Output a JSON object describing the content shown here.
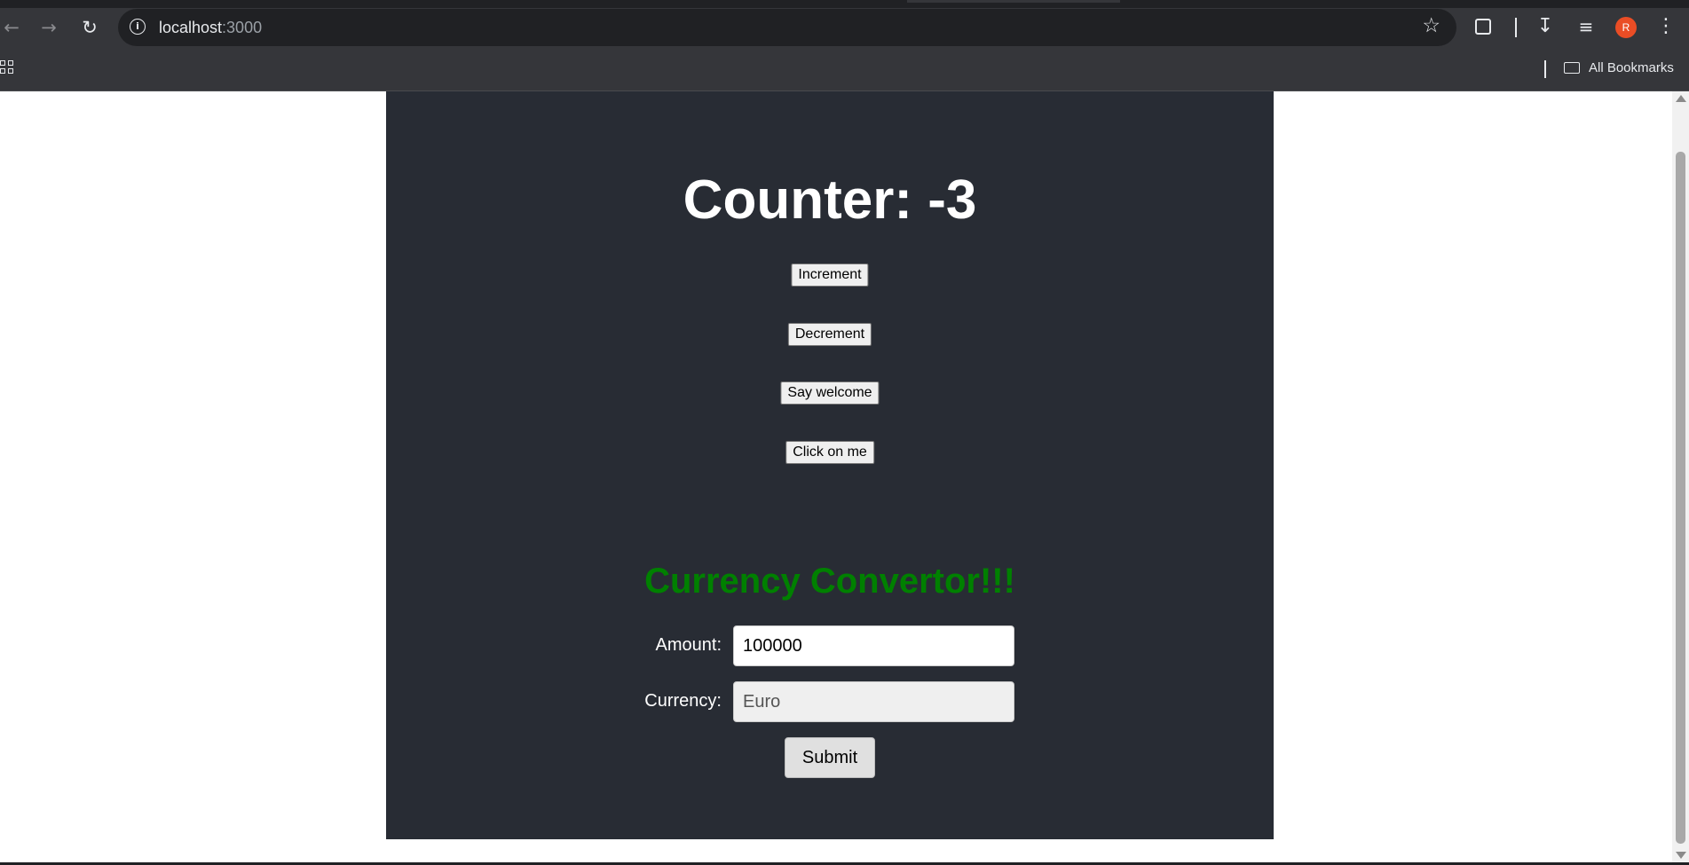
{
  "browser": {
    "url_host": "localhost",
    "url_port": ":3000",
    "bookmarks_label": "All Bookmarks",
    "profile_initial": "R",
    "profile_color": "#ea4d25",
    "icons": [
      "back-arrow-icon",
      "forward-arrow-icon",
      "reload-icon",
      "site-info-icon",
      "bookmark-star-icon",
      "extensions-icon",
      "download-icon",
      "media-control-icon",
      "menu-kebab-icon",
      "apps-grid-icon",
      "folder-icon"
    ]
  },
  "counter": {
    "title": "Counter: -3",
    "buttons": {
      "increment": "Increment",
      "decrement": "Decrement",
      "welcome": "Say welcome",
      "click": "Click on me"
    }
  },
  "converter": {
    "title": "Currency Convertor!!!",
    "title_color": "#008000",
    "amount_label": "Amount:",
    "amount_value": "100000",
    "currency_label": "Currency:",
    "currency_value": "Euro",
    "submit_label": "Submit"
  },
  "colors": {
    "app_background": "#282c34",
    "chrome_background": "#35363a"
  }
}
